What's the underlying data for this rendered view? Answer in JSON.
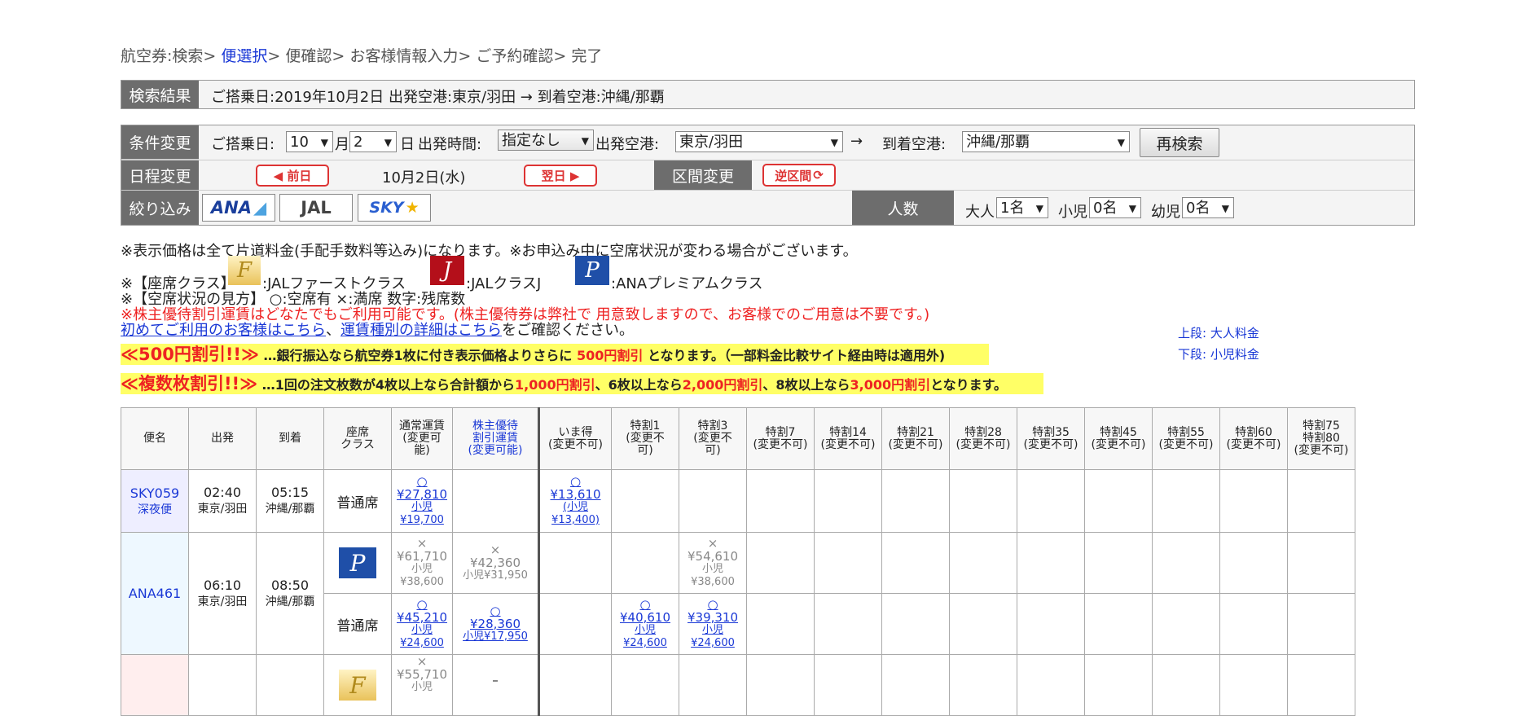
{
  "breadcrumb": {
    "step1": "航空券:検索",
    "sep": ">",
    "step2": "便選択",
    "step3": "便確認",
    "step4": "お客様情報入力",
    "step5": "ご予約確認",
    "step6": "完了"
  },
  "result": {
    "label": "検索結果",
    "text": "ご搭乗日:2019年10月2日  出発空港:東京/羽田  →  到着空港:沖縄/那覇"
  },
  "conditions": {
    "label": "条件変更",
    "date_label": "ご搭乗日:",
    "month": "10",
    "month_unit": "月",
    "day": "2",
    "day_unit": "日",
    "time_label": "出発時間:",
    "time_value": "指定なし",
    "dep_label": "出発空港:",
    "dep_value": "東京/羽田",
    "arrow": "→",
    "arr_label": "到着空港:",
    "arr_value": "沖縄/那覇",
    "research_button": "再検索"
  },
  "schedule": {
    "label": "日程変更",
    "prev_button": "◀ 前日",
    "current": "10月2日(水)",
    "next_button": "翌日 ▶",
    "route_label": "区間変更",
    "reverse_button": "逆区間"
  },
  "filter": {
    "label": "絞り込み",
    "airlines": [
      "ANA",
      "JAL",
      "SKY"
    ],
    "people_label": "人数",
    "adult_label": "大人",
    "adult_value": "1名",
    "child_label": "小児",
    "child_value": "0名",
    "infant_label": "幼児",
    "infant_value": "0名"
  },
  "notes": {
    "line1": "※表示価格は全て片道料金(手配手数料等込み)になります。※お申込み中に空席状況が変わる場合がございます。",
    "seat_class_prefix": "※【座席クラス】",
    "class_first": ":JALファーストクラス",
    "class_j": ":JALクラスJ",
    "class_premium": ":ANAプレミアムクラス",
    "availability": "※【空席状況の見方】 ○:空席有    ×:満席    数字:残席数",
    "shareholder": "※株主優待割引運賃はどなたでもご利用可能です。(株主優待券は弊社で 用意致しますので、お客様でのご用意は不要です。)",
    "first_time_link": "初めてご利用のお客様はこちら",
    "comma": "、",
    "fare_detail_link": "運賃種別の詳細はこちら",
    "confirm": "をご確認ください。",
    "upper_row": "上段: 大人料金",
    "lower_row": "下段: 小児料金"
  },
  "promo1": {
    "title": "≪500円割引!!≫",
    "text_a": "…銀行振込なら航空券1枚に付き表示価格よりさらに",
    "highlight": "500円割引",
    "text_b": "となります。（一部料金比較サイト経由時は適用外)"
  },
  "promo2": {
    "title": "≪複数枚割引!!≫",
    "text_a": "…1回の注文枚数が4枚以上なら合計額から",
    "h1": "1,000円割引",
    "text_b": "、6枚以上なら",
    "h2": "2,000円割引",
    "text_c": "、8枚以上なら",
    "h3": "3,000円割引",
    "text_d": "となります。"
  },
  "table": {
    "headers": [
      "便名",
      "出発",
      "到着",
      "座席\nクラス",
      "通常運賃\n(変更可\n能)",
      "株主優待\n割引運賃\n(変更可能)",
      "いま得\n(変更不可)",
      "特割1\n(変更不\n可)",
      "特割3\n(変更不\n可)",
      "特割7\n(変更不可)",
      "特割14\n(変更不可)",
      "特割21\n(変更不可)",
      "特割28\n(変更不可)",
      "特割35\n(変更不可)",
      "特割45\n(変更不可)",
      "特割55\n(変更不可)",
      "特割60\n(変更不可)",
      "特割75\n特割80\n(変更不可)"
    ],
    "rows": {
      "sky": {
        "flight": "SKY059",
        "sub": "深夜便",
        "dep_time": "02:40",
        "dep_airport": "東京/羽田",
        "arr_time": "05:15",
        "arr_airport": "沖縄/那覇",
        "seat": "普通席",
        "normal_mark": "○",
        "normal_price": "¥27,810",
        "normal_child": "小児",
        "normal_child_price": "¥19,700",
        "imatoku_mark": "○",
        "imatoku_price": "¥13,610",
        "imatoku_child": "(小児",
        "imatoku_child_price": "¥13,400)"
      },
      "ana": {
        "flight": "ANA461",
        "dep_time": "06:10",
        "dep_airport": "東京/羽田",
        "arr_time": "08:50",
        "arr_airport": "沖縄/那覇",
        "premium": {
          "normal_mark": "×",
          "normal_price": "¥61,710",
          "normal_child": "小児",
          "normal_child_price": "¥38,600",
          "kabu_mark": "×",
          "kabu_price": "¥42,360",
          "kabu_child": "小児¥31,950",
          "toku3_mark": "×",
          "toku3_price": "¥54,610",
          "toku3_child": "小児",
          "toku3_child_price": "¥38,600"
        },
        "regular": {
          "seat": "普通席",
          "normal_mark": "○",
          "normal_price": "¥45,210",
          "normal_child": "小児",
          "normal_child_price": "¥24,600",
          "kabu_mark": "○",
          "kabu_price": "¥28,360",
          "kabu_child": "小児¥17,950",
          "toku1_mark": "○",
          "toku1_price": "¥40,610",
          "toku1_child": "小児",
          "toku1_child_price": "¥24,600",
          "toku3_mark": "○",
          "toku3_price": "¥39,310",
          "toku3_child": "小児",
          "toku3_child_price": "¥24,600"
        }
      },
      "jal": {
        "normal_mark": "×",
        "normal_price": "¥55,710",
        "normal_child": "小児",
        "kabu": "–"
      }
    }
  },
  "icons": {
    "first": "JAL-first-icon",
    "classj": "JAL-classj-icon",
    "premium": "ANA-premium-icon"
  },
  "colors": {
    "label_bg": "#6d6d6d",
    "link": "#1a38d6",
    "red": "#e22",
    "promo_bg": "#ffff66",
    "sky_row": "#eeeeff",
    "ana_row": "#eef8ff",
    "jal_row": "#ffeeee"
  }
}
